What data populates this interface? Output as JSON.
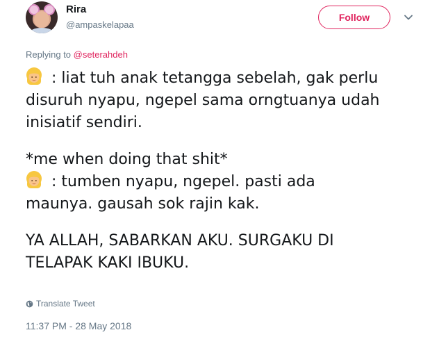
{
  "user": {
    "display_name": "Rira",
    "username": "@ampaskelapaa"
  },
  "follow_button": {
    "label": "Follow"
  },
  "menu": {
    "icon": "chevron-down-icon"
  },
  "reply": {
    "prefix": "Replying to",
    "mention": "@seterahdeh"
  },
  "tweet": {
    "emoji": "woman-blond-hair-emoji",
    "lines": [
      " : liat tuh anak tetangga sebelah, gak perlu",
      "disuruh nyapu, ngepel sama orngtuanya udah",
      "inisiatif sendiri.",
      "*me when doing that shit*",
      " : tumben nyapu, ngepel. pasti ada",
      "maunya. gausah sok rajin kak.",
      "YA ALLAH, SABARKAN AKU. SURGAKU DI",
      "TELAPAK KAKI IBUKU."
    ]
  },
  "translate": {
    "label": "Translate Tweet",
    "icon": "globe-icon"
  },
  "timestamp": "11:37 PM - 28 May 2018",
  "colors": {
    "accent": "#e0245e",
    "secondary_text": "#657786",
    "primary_text": "#14171a"
  }
}
